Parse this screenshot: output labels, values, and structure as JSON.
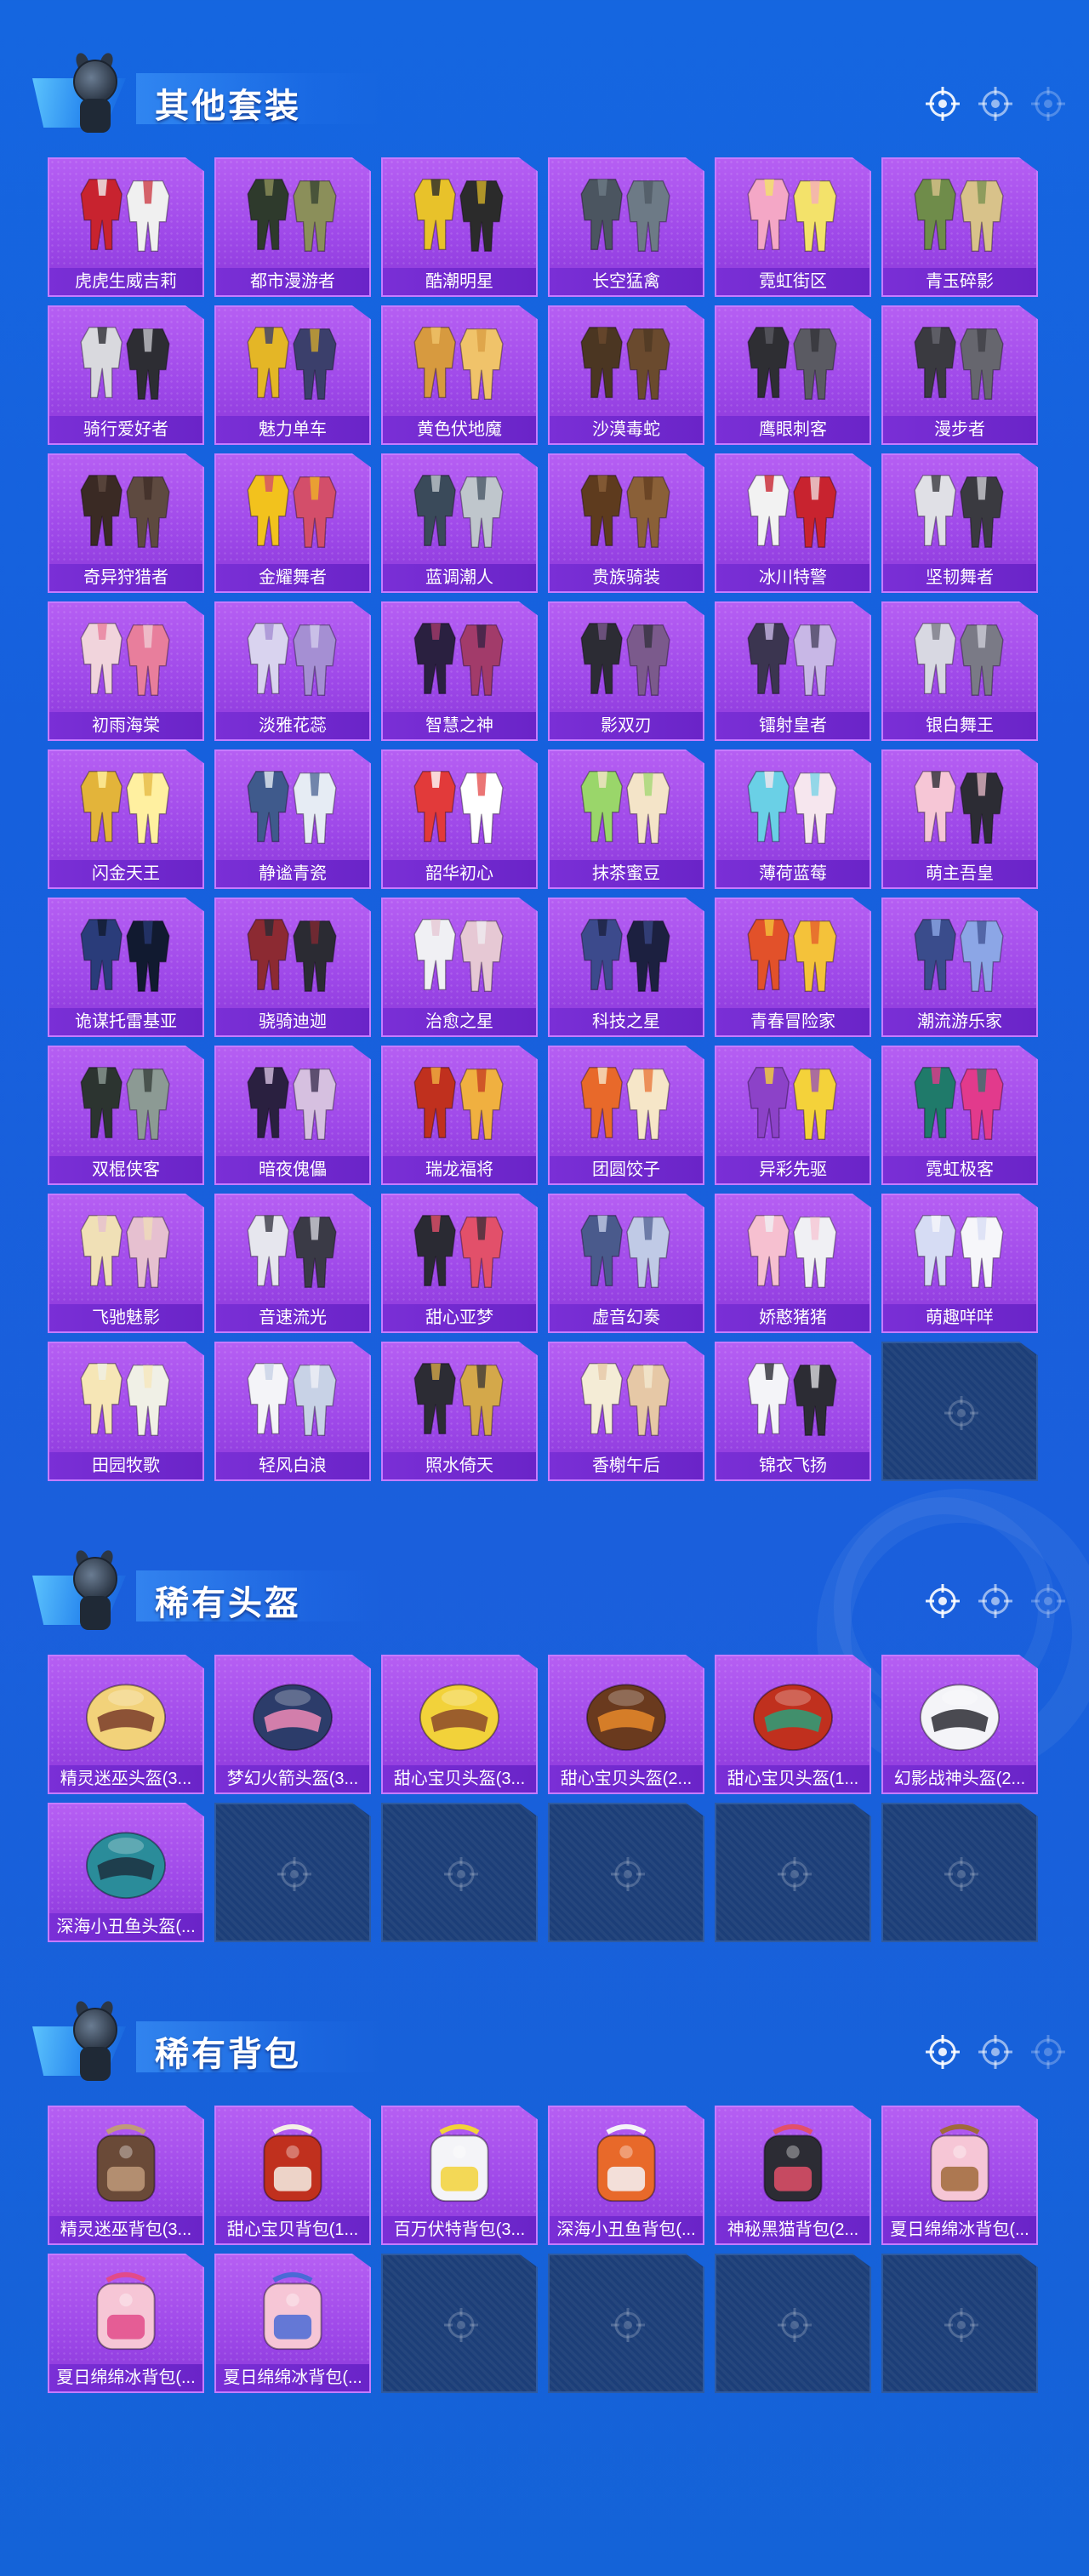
{
  "colors": {
    "background": "#1566e0",
    "card_purple": "#a553ee",
    "card_label": "#7a2fd6",
    "empty_slot": "#1c3e78"
  },
  "sections": [
    {
      "title": "其他套装",
      "icons": [
        "target-icon",
        "target-icon",
        "target-icon"
      ],
      "items": [
        "虎虎生威吉莉",
        "都市漫游者",
        "酷潮明星",
        "长空猛禽",
        "霓虹街区",
        "青玉碎影",
        "骑行爱好者",
        "魅力单车",
        "黄色伏地魔",
        "沙漠毒蛇",
        "鹰眼刺客",
        "漫步者",
        "奇异狩猎者",
        "金耀舞者",
        "蓝调潮人",
        "贵族骑装",
        "冰川特警",
        "坚韧舞者",
        "初雨海棠",
        "淡雅花蕊",
        "智慧之神",
        "影双刃",
        "镭射皇者",
        "银白舞王",
        "闪金天王",
        "静谧青瓷",
        "韶华初心",
        "抹茶蜜豆",
        "薄荷蓝莓",
        "萌主吾皇",
        "诡谋托雷基亚",
        "骁骑迪迦",
        "治愈之星",
        "科技之星",
        "青春冒险家",
        "潮流游乐家",
        "双棍侠客",
        "暗夜傀儡",
        "瑞龙福将",
        "团圆饺子",
        "异彩先驱",
        "霓虹极客",
        "飞驰魅影",
        "音速流光",
        "甜心亚梦",
        "虚音幻奏",
        "娇憨猪猪",
        "萌趣咩咩",
        "田园牧歌",
        "轻风白浪",
        "照水倚天",
        "香榭午后",
        "锦衣飞扬"
      ],
      "empty_slots": 1
    },
    {
      "title": "稀有头盔",
      "icons": [
        "target-icon",
        "target-icon",
        "target-icon"
      ],
      "items": [
        "精灵迷巫头盔(3...",
        "梦幻火箭头盔(3...",
        "甜心宝贝头盔(3...",
        "甜心宝贝头盔(2...",
        "甜心宝贝头盔(1...",
        "幻影战神头盔(2...",
        "深海小丑鱼头盔(..."
      ],
      "empty_slots": 5
    },
    {
      "title": "稀有背包",
      "icons": [
        "target-icon",
        "target-icon",
        "target-icon"
      ],
      "items": [
        "精灵迷巫背包(3...",
        "甜心宝贝背包(1...",
        "百万伏特背包(3...",
        "深海小丑鱼背包(...",
        "神秘黑猫背包(2...",
        "夏日绵绵冰背包(...",
        "夏日绵绵冰背包(...",
        "夏日绵绵冰背包(..."
      ],
      "empty_slots": 4
    }
  ]
}
